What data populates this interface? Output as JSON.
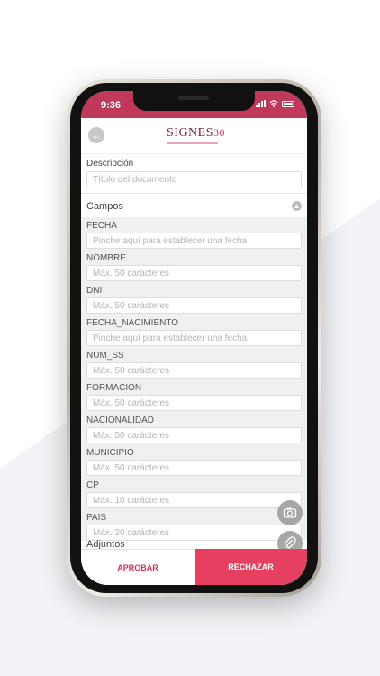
{
  "status": {
    "time": "9:36"
  },
  "header": {
    "logo_text": "SIGNES",
    "logo_num": "30"
  },
  "descripcion": {
    "label": "Descripción",
    "placeholder": "Título del documento"
  },
  "campos": {
    "title": "Campos",
    "items": [
      {
        "label": "FECHA",
        "placeholder": "Pinche aquí para establecer una fecha"
      },
      {
        "label": "NOMBRE",
        "placeholder": "Máx. 50 carácteres"
      },
      {
        "label": "DNI",
        "placeholder": "Máx. 50 carácteres"
      },
      {
        "label": "FECHA_NACIMIENTO",
        "placeholder": "Pinche aquí para establecer una fecha"
      },
      {
        "label": "NUM_SS",
        "placeholder": "Máx. 50 carácteres"
      },
      {
        "label": "FORMACION",
        "placeholder": "Máx. 50 carácteres"
      },
      {
        "label": "NACIONALIDAD",
        "placeholder": "Máx. 50 carácteres"
      },
      {
        "label": "MUNICIPIO",
        "placeholder": "Máx. 50 carácteres"
      },
      {
        "label": "CP",
        "placeholder": "Máx. 10 carácteres"
      },
      {
        "label": "PAIS",
        "placeholder": "Máx. 20 carácteres"
      }
    ]
  },
  "adjuntos": {
    "label": "Adjuntos"
  },
  "actions": {
    "approve": "APROBAR",
    "reject": "RECHAZAR"
  },
  "colors": {
    "brand": "#c0395a",
    "reject": "#e5405f",
    "approve_text": "#d63158"
  }
}
